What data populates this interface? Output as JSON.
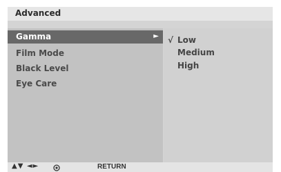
{
  "title": "Advanced",
  "menu": {
    "items": [
      {
        "label": "Gamma",
        "selected": true,
        "arrow": "►"
      },
      {
        "label": "Film Mode",
        "selected": false
      },
      {
        "label": "Black Level",
        "selected": false
      },
      {
        "label": "Eye Care",
        "selected": false
      }
    ]
  },
  "options": {
    "items": [
      {
        "label": "Low",
        "checked": true,
        "check": "√"
      },
      {
        "label": "Medium",
        "checked": false,
        "check": ""
      },
      {
        "label": "High",
        "checked": false,
        "check": ""
      }
    ]
  },
  "footer": {
    "nav_hint": "▲▼ ◄►",
    "ok_icon": "ok-button-icon",
    "return_label": "RETURN"
  },
  "colors": {
    "selected_bg": "#686868",
    "panel_left": "#c2c2c2",
    "panel_right": "#d1d1d1",
    "title_bg": "#e6e6e6"
  }
}
